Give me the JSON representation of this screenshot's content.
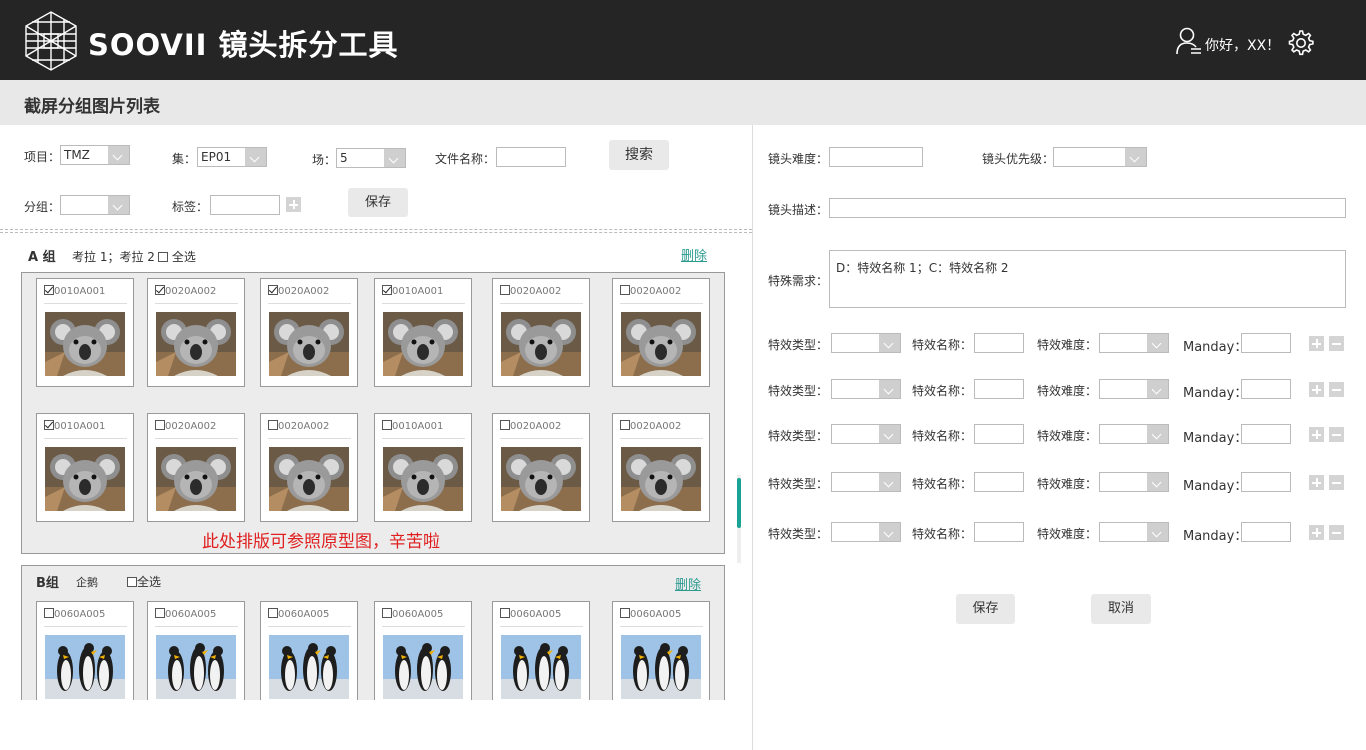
{
  "header": {
    "brand": "SOOVII 镜头拆分工具",
    "greeting": "你好，XX！"
  },
  "page_title": "截屏分组图片列表",
  "filters": {
    "project_label": "项目：",
    "project_value": "TMZ",
    "episode_label": "集：",
    "episode_value": "EP01",
    "scene_label": "场：",
    "scene_value": "5",
    "filename_label": "文件名称：",
    "search_button": "搜索",
    "group_label": "分组：",
    "tag_label": "标签：",
    "save_button": "保存"
  },
  "group_a": {
    "title": "A 组",
    "tags": "考拉 1；考拉 2",
    "select_all": "全选",
    "delete": "删除",
    "cards": [
      {
        "name": "0010A001",
        "checked": true
      },
      {
        "name": "0020A002",
        "checked": true
      },
      {
        "name": "0020A002",
        "checked": true
      },
      {
        "name": "0010A001",
        "checked": true
      },
      {
        "name": "0020A002",
        "checked": false
      },
      {
        "name": "0020A002",
        "checked": false
      },
      {
        "name": "0010A001",
        "checked": true
      },
      {
        "name": "0020A002",
        "checked": false
      },
      {
        "name": "0020A002",
        "checked": false
      },
      {
        "name": "0010A001",
        "checked": false
      },
      {
        "name": "0020A002",
        "checked": false
      },
      {
        "name": "0020A002",
        "checked": false
      }
    ],
    "note": "此处排版可参照原型图，辛苦啦"
  },
  "group_b": {
    "title": "B组",
    "tags": "企鹅",
    "select_all": "全选",
    "delete": "删除",
    "cards": [
      {
        "name": "0060A005",
        "checked": false
      },
      {
        "name": "0060A005",
        "checked": false
      },
      {
        "name": "0060A005",
        "checked": false
      },
      {
        "name": "0060A005",
        "checked": false
      },
      {
        "name": "0060A005",
        "checked": false
      },
      {
        "name": "0060A005",
        "checked": false
      }
    ]
  },
  "detail": {
    "difficulty_label": "镜头难度：",
    "priority_label": "镜头优先级：",
    "description_label": "镜头描述：",
    "special_label": "特殊需求：",
    "special_value": "D：特效名称 1；C：特效名称 2",
    "effect_rows": [
      {
        "type_label": "特效类型：",
        "name_label": "特效名称：",
        "diff_label": "特效难度：",
        "manday_label": "Manday："
      },
      {
        "type_label": "特效类型：",
        "name_label": "特效名称：",
        "diff_label": "特效难度：",
        "manday_label": "Manday："
      },
      {
        "type_label": "特效类型：",
        "name_label": "特效名称：",
        "diff_label": "特效难度：",
        "manday_label": "Manday："
      },
      {
        "type_label": "特效类型：",
        "name_label": "特效名称：",
        "diff_label": "特效难度：",
        "manday_label": "Manday："
      },
      {
        "type_label": "特效类型：",
        "name_label": "特效名称：",
        "diff_label": "特效难度：",
        "manday_label": "Manday："
      }
    ],
    "save_button": "保存",
    "cancel_button": "取消"
  }
}
